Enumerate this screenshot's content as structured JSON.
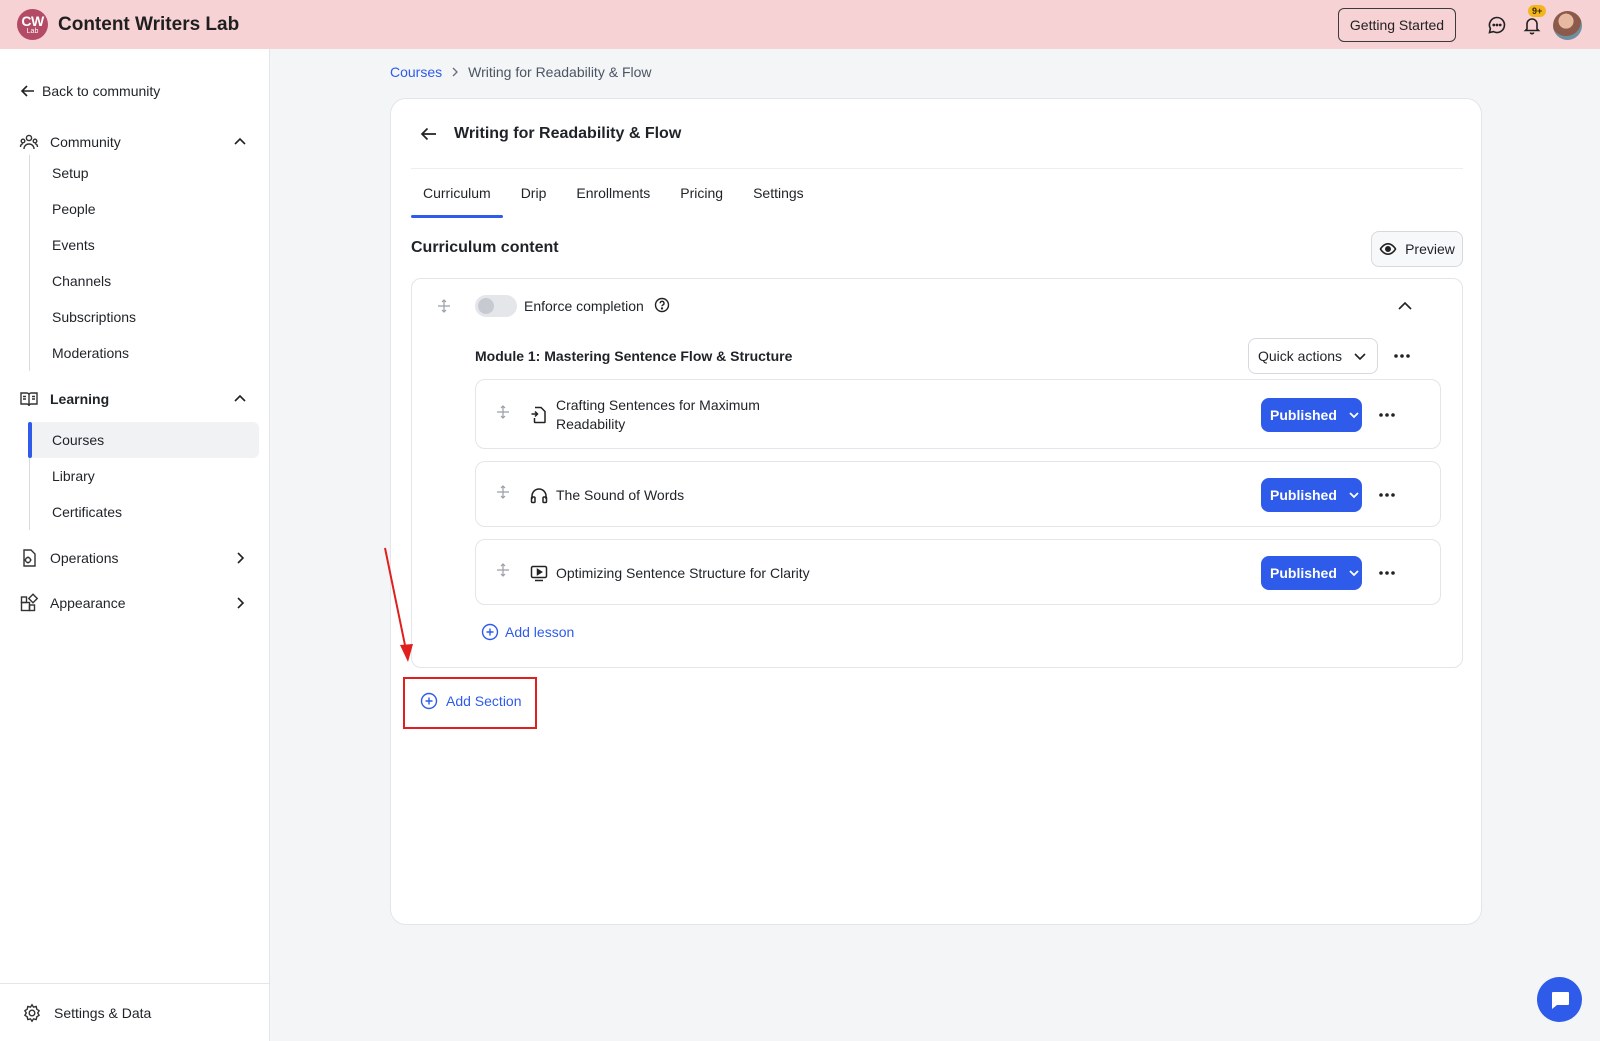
{
  "app": {
    "logo_top": "CW",
    "logo_bottom": "Lab",
    "title": "Content Writers Lab",
    "getting_started": "Getting Started",
    "notification_count": "9+"
  },
  "sidebar": {
    "back": "Back to community",
    "groups": [
      {
        "label": "Community",
        "icon": "community-icon",
        "expanded": true,
        "items": [
          "Setup",
          "People",
          "Events",
          "Channels",
          "Subscriptions",
          "Moderations"
        ]
      },
      {
        "label": "Learning",
        "icon": "book-icon",
        "expanded": true,
        "items": [
          "Courses",
          "Library",
          "Certificates"
        ],
        "active": "Courses"
      },
      {
        "label": "Operations",
        "icon": "operations-icon",
        "expanded": false
      },
      {
        "label": "Appearance",
        "icon": "appearance-icon",
        "expanded": false
      }
    ],
    "footer": "Settings & Data"
  },
  "breadcrumb": {
    "root": "Courses",
    "current": "Writing for Readability & Flow"
  },
  "course": {
    "title": "Writing for Readability & Flow",
    "tabs": [
      "Curriculum",
      "Drip",
      "Enrollments",
      "Pricing",
      "Settings"
    ],
    "active_tab": "Curriculum",
    "section_title": "Curriculum content",
    "preview": "Preview",
    "enforce_completion": "Enforce completion",
    "enforce_enabled": false,
    "module": {
      "title": "Module 1: Mastering Sentence Flow & Structure",
      "quick_actions": "Quick actions",
      "lessons": [
        {
          "title_line1": "Crafting Sentences for Maximum",
          "title_line2": "Readability",
          "type": "document-icon",
          "status": "Published"
        },
        {
          "title_line1": "The Sound of Words",
          "type": "headphones-icon",
          "status": "Published"
        },
        {
          "title_line1": "Optimizing Sentence Structure for Clarity",
          "type": "video-icon",
          "status": "Published"
        }
      ],
      "add_lesson": "Add lesson"
    },
    "add_section": "Add Section"
  },
  "colors": {
    "accent": "#2f5bea",
    "topbar": "#f7d2d4",
    "annotation": "#e0201e"
  }
}
